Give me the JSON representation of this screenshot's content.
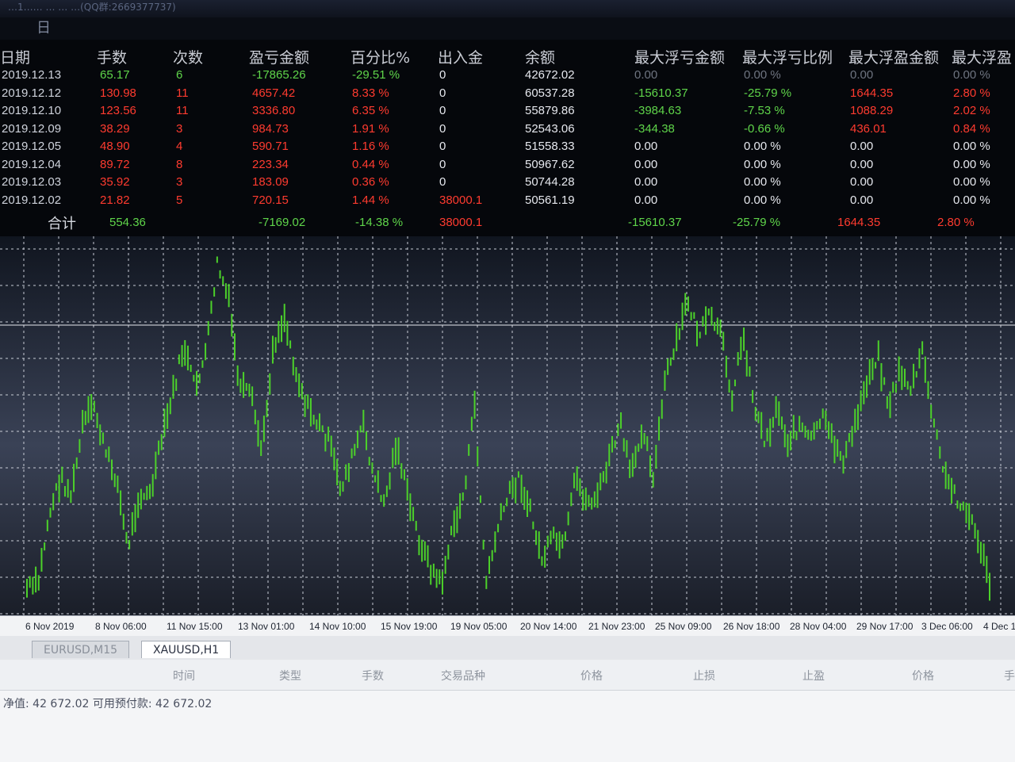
{
  "window": {
    "title": "…1…… … … …(QQ群:2669377737)"
  },
  "period_tab": "日",
  "stats": {
    "headers": [
      "日期",
      "手数",
      "次数",
      "盈亏金额",
      "百分比%",
      "出入金",
      "余额",
      "最大浮亏金额",
      "最大浮亏比例",
      "最大浮盈金额",
      "最大浮盈"
    ],
    "rows": [
      {
        "date": "2019.12.13",
        "lots": "65.17",
        "trades": "6",
        "pnl": "-17865.26",
        "pct": "-29.51 %",
        "flow": "0",
        "balance": "42672.02",
        "max_dd": "0.00",
        "max_dd_pct": "0.00 %",
        "max_fp": "0.00",
        "max_fp_pct": "0.00 %"
      },
      {
        "date": "2019.12.12",
        "lots": "130.98",
        "trades": "11",
        "pnl": "4657.42",
        "pct": "8.33 %",
        "flow": "0",
        "balance": "60537.28",
        "max_dd": "-15610.37",
        "max_dd_pct": "-25.79 %",
        "max_fp": "1644.35",
        "max_fp_pct": "2.80 %"
      },
      {
        "date": "2019.12.10",
        "lots": "123.56",
        "trades": "11",
        "pnl": "3336.80",
        "pct": "6.35 %",
        "flow": "0",
        "balance": "55879.86",
        "max_dd": "-3984.63",
        "max_dd_pct": "-7.53 %",
        "max_fp": "1088.29",
        "max_fp_pct": "2.02 %"
      },
      {
        "date": "2019.12.09",
        "lots": "38.29",
        "trades": "3",
        "pnl": "984.73",
        "pct": "1.91 %",
        "flow": "0",
        "balance": "52543.06",
        "max_dd": "-344.38",
        "max_dd_pct": "-0.66 %",
        "max_fp": "436.01",
        "max_fp_pct": "0.84 %"
      },
      {
        "date": "2019.12.05",
        "lots": "48.90",
        "trades": "4",
        "pnl": "590.71",
        "pct": "1.16 %",
        "flow": "0",
        "balance": "51558.33",
        "max_dd": "0.00",
        "max_dd_pct": "0.00 %",
        "max_fp": "0.00",
        "max_fp_pct": "0.00 %"
      },
      {
        "date": "2019.12.04",
        "lots": "89.72",
        "trades": "8",
        "pnl": "223.34",
        "pct": "0.44 %",
        "flow": "0",
        "balance": "50967.62",
        "max_dd": "0.00",
        "max_dd_pct": "0.00 %",
        "max_fp": "0.00",
        "max_fp_pct": "0.00 %"
      },
      {
        "date": "2019.12.03",
        "lots": "35.92",
        "trades": "3",
        "pnl": "183.09",
        "pct": "0.36 %",
        "flow": "0",
        "balance": "50744.28",
        "max_dd": "0.00",
        "max_dd_pct": "0.00 %",
        "max_fp": "0.00",
        "max_fp_pct": "0.00 %"
      },
      {
        "date": "2019.12.02",
        "lots": "21.82",
        "trades": "5",
        "pnl": "720.15",
        "pct": "1.44 %",
        "flow": "38000.1",
        "balance": "50561.19",
        "max_dd": "0.00",
        "max_dd_pct": "0.00 %",
        "max_fp": "0.00",
        "max_fp_pct": "0.00 %"
      }
    ],
    "totals": {
      "label": "合计",
      "lots": "554.36",
      "pnl": "-7169.02",
      "pct": "-14.38 %",
      "flow": "38000.1",
      "max_dd": "-15610.37",
      "max_dd_pct": "-25.79 %",
      "max_fp": "1644.35",
      "max_fp_pct": "2.80 %"
    }
  },
  "chart": {
    "symbol_tab": "XAUUSD,H1",
    "line_color": "#4cd12a",
    "x_labels": [
      "6 Nov 2019",
      "8 Nov 06:00",
      "11 Nov 15:00",
      "13 Nov 01:00",
      "14 Nov 10:00",
      "15 Nov 19:00",
      "19 Nov 05:00",
      "20 Nov 14:00",
      "21 Nov 23:00",
      "25 Nov 09:00",
      "26 Nov 18:00",
      "28 Nov 04:00",
      "29 Nov 17:00",
      "3 Dec 06:00",
      "4 Dec 1"
    ],
    "price_path": [
      0.04,
      0.05,
      0.25,
      0.35,
      0.3,
      0.5,
      0.55,
      0.42,
      0.35,
      0.15,
      0.3,
      0.3,
      0.45,
      0.58,
      0.72,
      0.6,
      0.7,
      0.95,
      0.85,
      0.6,
      0.58,
      0.42,
      0.72,
      0.8,
      0.65,
      0.55,
      0.5,
      0.45,
      0.32,
      0.4,
      0.5,
      0.35,
      0.28,
      0.45,
      0.3,
      0.18,
      0.1,
      0.05,
      0.2,
      0.3,
      0.55,
      0.05,
      0.2,
      0.3,
      0.35,
      0.25,
      0.12,
      0.18,
      0.15,
      0.35,
      0.28,
      0.3,
      0.4,
      0.5,
      0.35,
      0.5,
      0.35,
      0.62,
      0.72,
      0.85,
      0.75,
      0.8,
      0.75,
      0.58,
      0.75,
      0.55,
      0.45,
      0.55,
      0.45,
      0.5,
      0.45,
      0.52,
      0.45,
      0.4,
      0.5,
      0.62,
      0.7,
      0.55,
      0.65,
      0.6,
      0.7,
      0.5,
      0.35,
      0.3,
      0.25,
      0.18,
      0.05
    ]
  },
  "terminal": {
    "tabs": [
      "EURUSD,M15",
      "XAUUSD,H1"
    ],
    "columns": [
      "时间",
      "类型",
      "手数",
      "交易品种",
      "价格",
      "止损",
      "止盈",
      "价格",
      "手"
    ],
    "status": "净值: 42 672.02   可用预付款: 42 672.02"
  }
}
